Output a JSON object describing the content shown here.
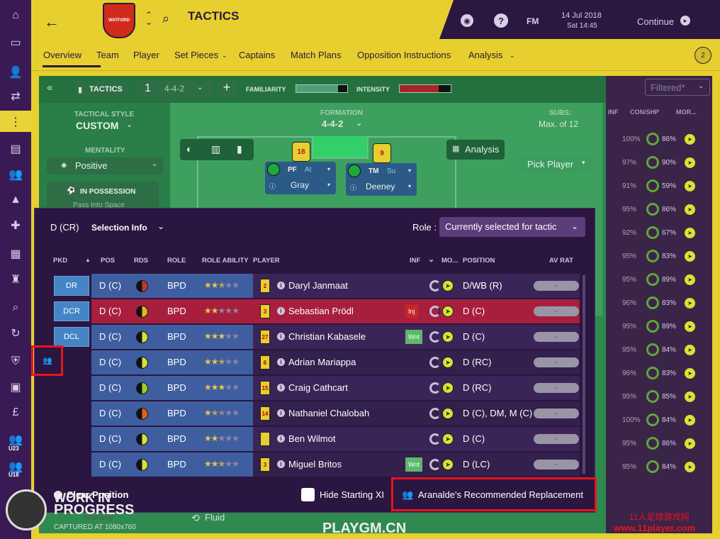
{
  "header": {
    "title": "TACTICS",
    "date": "14 Jul 2018",
    "time": "Sat 14:45",
    "fm_label": "FM",
    "continue_label": "Continue",
    "club_badge": "WATFORD",
    "notifications": "2"
  },
  "nav": {
    "tabs": [
      "Overview",
      "Team",
      "Player",
      "Set Pieces",
      "Captains",
      "Match Plans",
      "Opposition Instructions",
      "Analysis"
    ],
    "active": "Overview"
  },
  "tactics": {
    "header_label": "TACTICS",
    "slot": "1",
    "formation_short": "4-4-2",
    "familiarity_label": "FAMILIARITY",
    "intensity_label": "INTENSITY",
    "tactical_style_label": "TACTICAL STYLE",
    "tactical_style": "CUSTOM",
    "mentality_label": "MENTALITY",
    "mentality": "Positive",
    "in_possession_label": "IN POSSESSION",
    "in_possession_sub": "Pass Into Space",
    "formation_label": "FORMATION",
    "formation": "4-4-2",
    "subs_label": "SUBS:",
    "subs_value": "Max. of 12",
    "pick_player": "Pick Player",
    "analysis_label": "Analysis",
    "fluid_label": "Fluid",
    "intensity_sub": "Intensity",
    "filter_value": "Filtered*",
    "right_inf": "INF",
    "right_con": "CON/SHP",
    "right_mor": "MOR..."
  },
  "pitch_players": [
    {
      "number": "18",
      "role": "PF",
      "duty": "At",
      "name": "Gray"
    },
    {
      "number": "9",
      "role": "TM",
      "duty": "Su",
      "name": "Deeney"
    }
  ],
  "modal": {
    "position": "D (CR)",
    "selection_info": "Selection Info",
    "role_label": "Role :",
    "role_value": "Currently selected for tactic",
    "clear_position": "Clear Position",
    "hide_starting_xi": "Hide Starting XI",
    "recommended": "Aranalde's Recommended Replacement",
    "columns": [
      "PKD",
      "POS",
      "RDS",
      "ROLE",
      "ROLE ABILITY",
      "PLAYER",
      "INF",
      "MO...",
      "POSITION",
      "AV RAT"
    ],
    "rows": [
      {
        "pkd": "DR",
        "pos": "D (C)",
        "role": "BPD",
        "stars": 2.5,
        "shirt": "2",
        "player": "Daryl Janmaat",
        "inf": "",
        "position": "D/WB (R)",
        "avrat": "-",
        "rds": "#c0392b",
        "highlight": false
      },
      {
        "pkd": "DCR",
        "pos": "D (C)",
        "role": "BPD",
        "stars": 2,
        "shirt": "3",
        "player": "Sebastian Prödl",
        "inf": "Inj",
        "position": "D (C)",
        "avrat": "-",
        "rds": "#e0b81d",
        "highlight": true
      },
      {
        "pkd": "DCL",
        "pos": "D (C)",
        "role": "BPD",
        "stars": 3,
        "shirt": "27",
        "player": "Christian Kabasele",
        "inf": "Wnt",
        "position": "D (C)",
        "avrat": "-",
        "rds": "#d6e03a",
        "highlight": false
      },
      {
        "pkd": "",
        "pos": "D (C)",
        "role": "BPD",
        "stars": 2.5,
        "shirt": "6",
        "player": "Adrian Mariappa",
        "inf": "",
        "position": "D (RC)",
        "avrat": "-",
        "rds": "#d6e03a",
        "highlight": false
      },
      {
        "pkd": "",
        "pos": "D (C)",
        "role": "BPD",
        "stars": 3,
        "shirt": "15",
        "player": "Craig Cathcart",
        "inf": "",
        "position": "D (RC)",
        "avrat": "-",
        "rds": "#9bcf2a",
        "highlight": false
      },
      {
        "pkd": "",
        "pos": "D (C)",
        "role": "BPD",
        "stars": 1.5,
        "shirt": "14",
        "player": "Nathaniel Chalobah",
        "inf": "",
        "position": "D (C), DM, M (C)",
        "avrat": "-",
        "rds": "#e0601d",
        "highlight": false
      },
      {
        "pkd": "",
        "pos": "D (C)",
        "role": "BPD",
        "stars": 2,
        "shirt": "",
        "player": "Ben Wilmot",
        "inf": "",
        "position": "D (C)",
        "avrat": "-",
        "rds": "#d6e03a",
        "highlight": false
      },
      {
        "pkd": "",
        "pos": "D (C)",
        "role": "BPD",
        "stars": 2.5,
        "shirt": "3",
        "player": "Miguel Britos",
        "inf": "Wnt",
        "position": "D (LC)",
        "avrat": "-",
        "rds": "#d6e03a",
        "highlight": false
      }
    ]
  },
  "right_panel": [
    {
      "pct1": "100%",
      "pct2": "86%"
    },
    {
      "pct1": "97%",
      "pct2": "90%"
    },
    {
      "pct1": "91%",
      "pct2": "59%"
    },
    {
      "pct1": "95%",
      "pct2": "86%"
    },
    {
      "pct1": "92%",
      "pct2": "67%"
    },
    {
      "pct1": "95%",
      "pct2": "83%"
    },
    {
      "pct1": "95%",
      "pct2": "89%"
    },
    {
      "pct1": "96%",
      "pct2": "83%"
    },
    {
      "pct1": "95%",
      "pct2": "89%"
    },
    {
      "pct1": "95%",
      "pct2": "84%"
    },
    {
      "pct1": "96%",
      "pct2": "83%"
    },
    {
      "pct1": "95%",
      "pct2": "85%"
    },
    {
      "pct1": "100%",
      "pct2": "84%"
    },
    {
      "pct1": "95%",
      "pct2": "86%"
    },
    {
      "pct1": "95%",
      "pct2": "84%"
    }
  ],
  "watermark": {
    "line1": "WORK IN",
    "line2": "PROGRESS",
    "line3": "CAPTURED AT 1080x760",
    "site1": "PLAYGM.CN",
    "site2": "11人足球游戏网",
    "site3": "www.11player.com"
  },
  "colors": {
    "accent": "#e7cf2f",
    "panel": "#2a1640",
    "highlight": "#e8141e"
  }
}
